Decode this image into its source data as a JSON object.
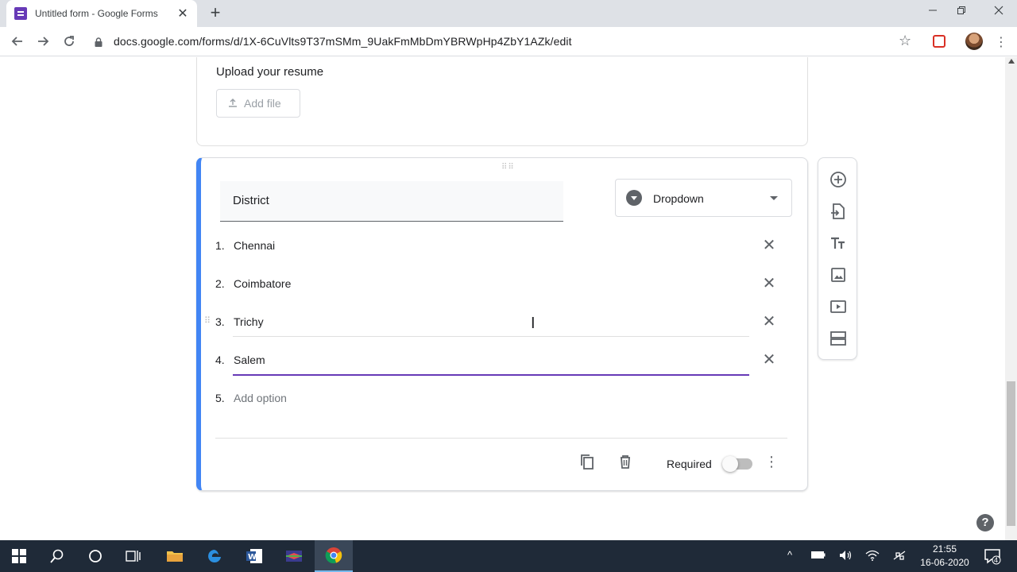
{
  "browser": {
    "tab_title": "Untitled form - Google Forms",
    "tab_close": "✕",
    "new_tab": "+",
    "url": "docs.google.com/forms/d/1X-6CuVlts9T37mSMm_9UakFmMbDmYBRWpHp4ZbY1AZk/edit"
  },
  "prev_question": {
    "title": "Upload your resume",
    "add_file_label": "Add file"
  },
  "question": {
    "title": "District",
    "type_label": "Dropdown",
    "options": [
      {
        "num": "1.",
        "text": "Chennai"
      },
      {
        "num": "2.",
        "text": "Coimbatore"
      },
      {
        "num": "3.",
        "text": "Trichy"
      },
      {
        "num": "4.",
        "text": "Salem"
      }
    ],
    "add_option": {
      "num": "5.",
      "text": "Add option"
    },
    "required_label": "Required",
    "required_on": false
  },
  "help": "?",
  "clock": {
    "time": "21:55",
    "date": "16-06-2020"
  },
  "notifications_count": "4",
  "colors": {
    "accent_blue": "#4285f4",
    "forms_purple": "#673ab7"
  }
}
